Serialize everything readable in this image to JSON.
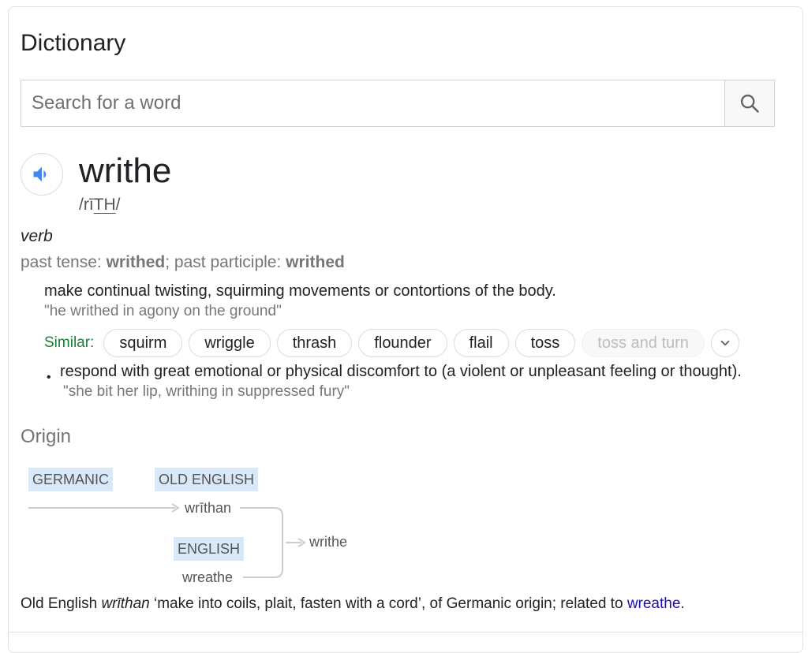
{
  "title": "Dictionary",
  "search": {
    "placeholder": "Search for a word",
    "icon": "search-icon"
  },
  "entry": {
    "word": "writhe",
    "pronunciation": {
      "before": "/ri",
      "underlined": "TH",
      "after": "/"
    },
    "pronunciation_macron": "ī",
    "part_of_speech": "verb",
    "forms": {
      "past_label": "past tense: ",
      "past_value": "writhed",
      "sep": "; ",
      "participle_label": "past participle: ",
      "participle_value": "writhed"
    },
    "senses": [
      {
        "definition": "make continual twisting, squirming movements or contortions of the body.",
        "example": "\"he writhed in agony on the ground\"",
        "similar_label": "Similar:",
        "similar": [
          "squirm",
          "wriggle",
          "thrash",
          "flounder",
          "flail",
          "toss",
          "toss and turn"
        ]
      },
      {
        "bullet": "•",
        "definition": "respond with great emotional or physical discomfort to (a violent or unpleasant feeling or thought).",
        "example": "\"she bit her lip, writhing in suppressed fury\""
      }
    ]
  },
  "origin": {
    "title": "Origin",
    "tags": {
      "germanic": "GERMANIC",
      "old_english": "OLD ENGLISH",
      "english": "ENGLISH"
    },
    "words": {
      "writhan": "wrīthan",
      "wreathe": "wreathe",
      "writhe": "writhe"
    },
    "text": {
      "prefix": "Old English ",
      "italic": "wrīthan",
      "middle": " ‘make into coils, plait, fasten with a cord’, of Germanic origin; related to ",
      "link": "wreathe",
      "suffix": "."
    }
  },
  "colors": {
    "accent": "#4285f4",
    "similar": "#188038",
    "link": "#1a0dab",
    "tag_bg": "#d8e8f8"
  }
}
